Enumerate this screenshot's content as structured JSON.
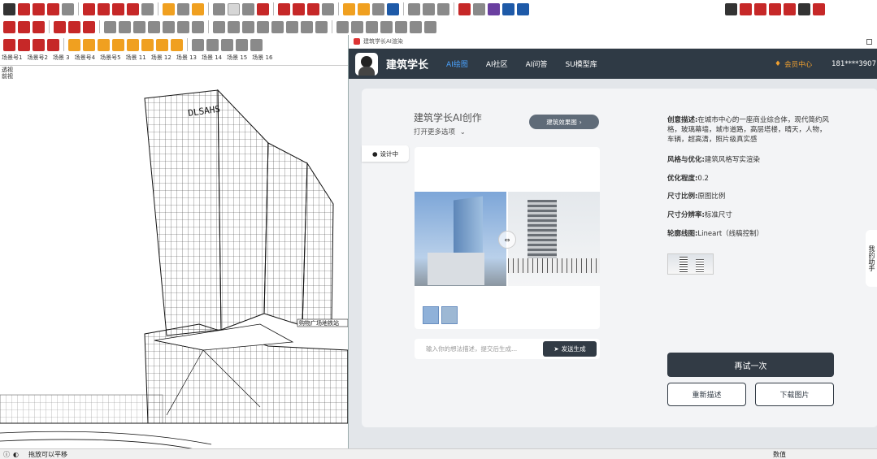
{
  "toolbar": {
    "colors": [
      "#c62828",
      "#8a8a8a",
      "#f0a020",
      "#1e5aa8"
    ]
  },
  "sketchup": {
    "scene_tabs": [
      "场景号1",
      "场景号2",
      "场景 3",
      "场景号4",
      "场景号5",
      "场景 11",
      "场景 12",
      "场景 13",
      "场景 14",
      "场景 15",
      "场景 16"
    ],
    "viewport_labels": [
      "透视",
      "前视"
    ],
    "building_sign": "DLSAHS",
    "podium_sign": "购物广场地铁站",
    "status_text": "拖放可以平移",
    "status_right": "数值"
  },
  "app": {
    "window_title": "建筑学长AI渲染",
    "brand": "建筑学长",
    "nav": [
      "AI绘图",
      "AI社区",
      "AI问答",
      "SU模型库"
    ],
    "nav_active": 0,
    "vip_label": "会员中心",
    "user_phone": "181****3907",
    "panel_title": "建筑学长AI创作",
    "panel_subtitle": "打开更多选项",
    "badge_text": "建筑效果图",
    "side_tab": "设计中",
    "input_placeholder": "输入你的想法描述，提交后生成...",
    "send_label": "发送生成",
    "props": [
      {
        "label": "创意描述:",
        "value": "在城市中心的一座商业综合体，现代简约风格，玻璃幕墙，城市道路，高层塔楼，晴天，人物，车辆，超高清，照片级真实感"
      },
      {
        "label": "风格与优化:",
        "value": "建筑风格写实渲染"
      },
      {
        "label": "优化程度:",
        "value": "0.2"
      },
      {
        "label": "尺寸比例:",
        "value": "原图比例"
      },
      {
        "label": "尺寸分辨率:",
        "value": "标准尺寸"
      },
      {
        "label": "轮廓线图:",
        "value": "Lineart（线稿控制）"
      }
    ],
    "retry_label": "再试一次",
    "redescribe_label": "重新描述",
    "download_label": "下载图片",
    "side_widget": "我的助手"
  },
  "colors": {
    "accent": "#4aa3ff",
    "nav_bg": "#2f3a45",
    "vip": "#f0a030",
    "button_dark": "#323b45"
  }
}
